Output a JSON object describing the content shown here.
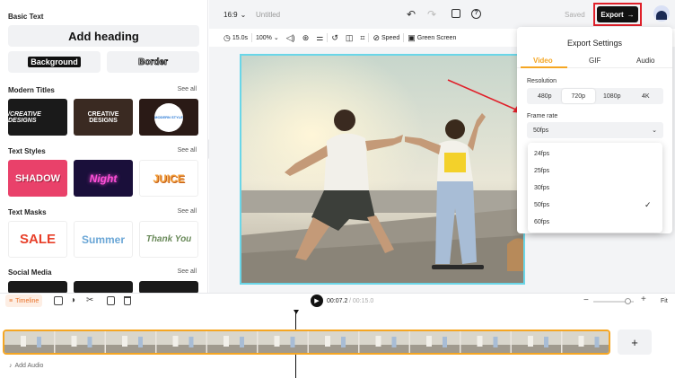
{
  "left_panel": {
    "basic_text": {
      "title": "Basic Text",
      "add_heading": "Add heading",
      "background": "Background",
      "border": "Border"
    },
    "modern_titles": {
      "title": "Modern Titles",
      "see_all": "See all",
      "tiles": [
        "/CREATIVE DESIGNS",
        "CREATIVE DESIGNS",
        "MODERN STYLE"
      ]
    },
    "text_styles": {
      "title": "Text Styles",
      "see_all": "See all",
      "tiles": [
        "SHADOW",
        "Night",
        "JUICE"
      ]
    },
    "text_masks": {
      "title": "Text Masks",
      "see_all": "See all",
      "tiles": [
        "SALE",
        "Summer",
        "Thank You"
      ]
    },
    "social_media": {
      "title": "Social Media",
      "see_all": "See all"
    }
  },
  "topbar": {
    "aspect": "16:9",
    "project_name": "Untitled",
    "saved": "Saved",
    "export_label": "Export"
  },
  "toolbar": {
    "duration": "15.0s",
    "zoom": "100%",
    "speed": "Speed",
    "green_screen": "Green Screen"
  },
  "export_settings": {
    "title": "Export Settings",
    "tabs": [
      "Video",
      "GIF",
      "Audio"
    ],
    "active_tab": "Video",
    "resolution_label": "Resolution",
    "resolutions": [
      "480p",
      "720p",
      "1080p",
      "4K"
    ],
    "selected_resolution": "720p",
    "frame_rate_label": "Frame rate",
    "frame_rate_value": "50fps",
    "frame_rate_options": [
      "24fps",
      "25fps",
      "30fps",
      "50fps",
      "60fps"
    ],
    "selected_frame_rate": "50fps"
  },
  "timeline": {
    "label": "Timeline",
    "current_time": "00:07.2",
    "total_time": "/ 00:15.0",
    "fit": "Fit",
    "add_audio": "Add Audio"
  },
  "colors": {
    "accent": "#e43b6a",
    "export_btn": "#111111",
    "selection_border": "#f5a623",
    "canvas_border": "#6ad6e8",
    "highlight_box": "#e0202a"
  }
}
